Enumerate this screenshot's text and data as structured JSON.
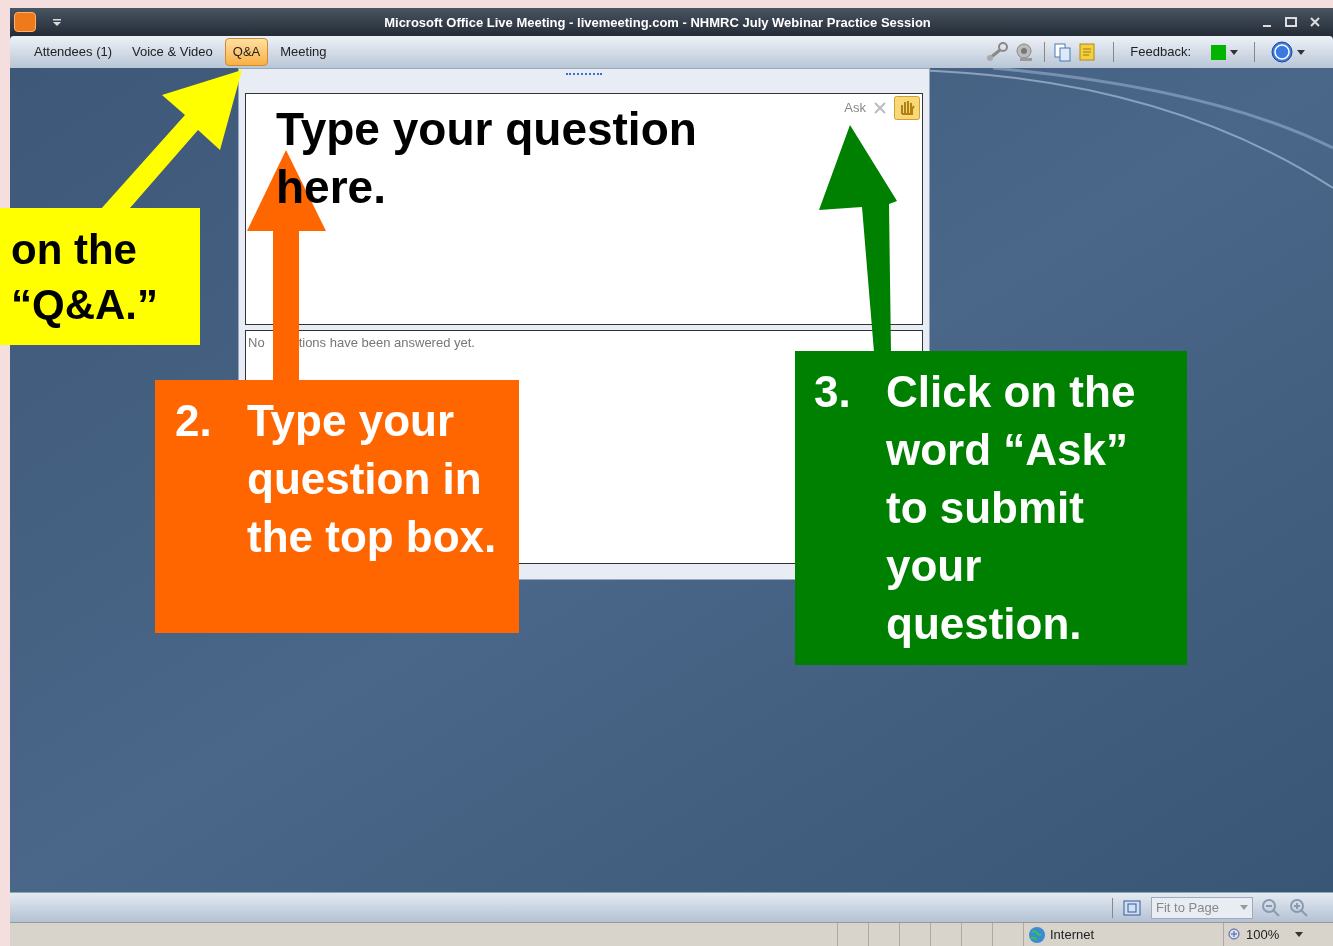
{
  "window": {
    "title": "Microsoft Office Live Meeting - livemeeting.com - NHMRC July Webinar Practice Session"
  },
  "menu": [
    {
      "label": "Attendees (1)",
      "selected": false
    },
    {
      "label": "Voice & Video",
      "selected": false
    },
    {
      "label": "Q&A",
      "selected": true
    },
    {
      "label": "Meeting",
      "selected": false
    }
  ],
  "feedback": {
    "label": "Feedback:",
    "color": "#00b400"
  },
  "qa_panel": {
    "ask_label": "Ask",
    "question_value": "Type your question here.",
    "answers_text_start": "No",
    "answers_text_end": "tions have been answered yet."
  },
  "bottom_bar": {
    "zoom_mode": "Fit to Page"
  },
  "status_bar": {
    "zone": "Internet",
    "zoom": "100%"
  },
  "callouts": [
    {
      "text": "on the “Q&A.”",
      "color": "#ffff00"
    },
    {
      "number": "2.",
      "text": "Type your question in the top box.",
      "color": "#ff6600"
    },
    {
      "number": "3.",
      "text": "Click on the word “Ask” to submit your question.",
      "color": "#008000"
    }
  ]
}
